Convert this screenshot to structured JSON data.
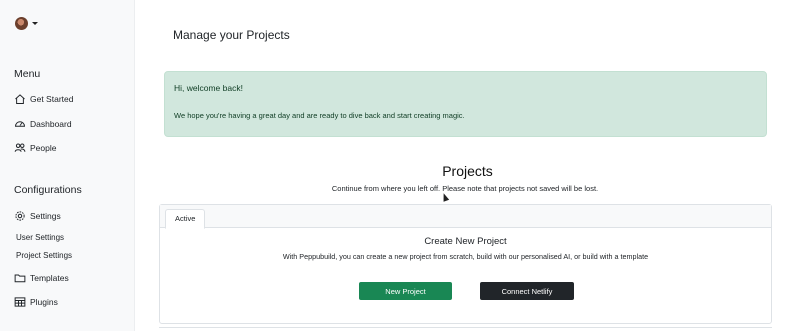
{
  "sidebar": {
    "menu_title": "Menu",
    "menu_items": [
      {
        "label": "Get Started",
        "icon": "home-icon"
      },
      {
        "label": "Dashboard",
        "icon": "speedometer-icon"
      },
      {
        "label": "People",
        "icon": "people-icon"
      }
    ],
    "config_title": "Configurations",
    "settings_label": "Settings",
    "user_settings_label": "User Settings",
    "project_settings_label": "Project Settings",
    "templates_label": "Templates",
    "plugins_label": "Plugins"
  },
  "main": {
    "page_title": "Manage your Projects",
    "alert": {
      "title": "Hi, welcome back!",
      "text": "We hope you're having a great day and are ready to dive back and start creating magic.",
      "color": "#d1e7dd"
    },
    "projects_heading": "Projects",
    "projects_subtitle": "Continue from where you left off. Please note that projects not saved will be lost.",
    "tab_active": "Active",
    "card_title": "Create New Project",
    "card_text": "With Peppubuild, you can create a new project from scratch, build with our personalised AI, or build with a template",
    "new_project_button": "New Project",
    "connect_netlify_button": "Connect Netlify",
    "new_project_color": "#198754",
    "netlify_color": "#212529"
  }
}
